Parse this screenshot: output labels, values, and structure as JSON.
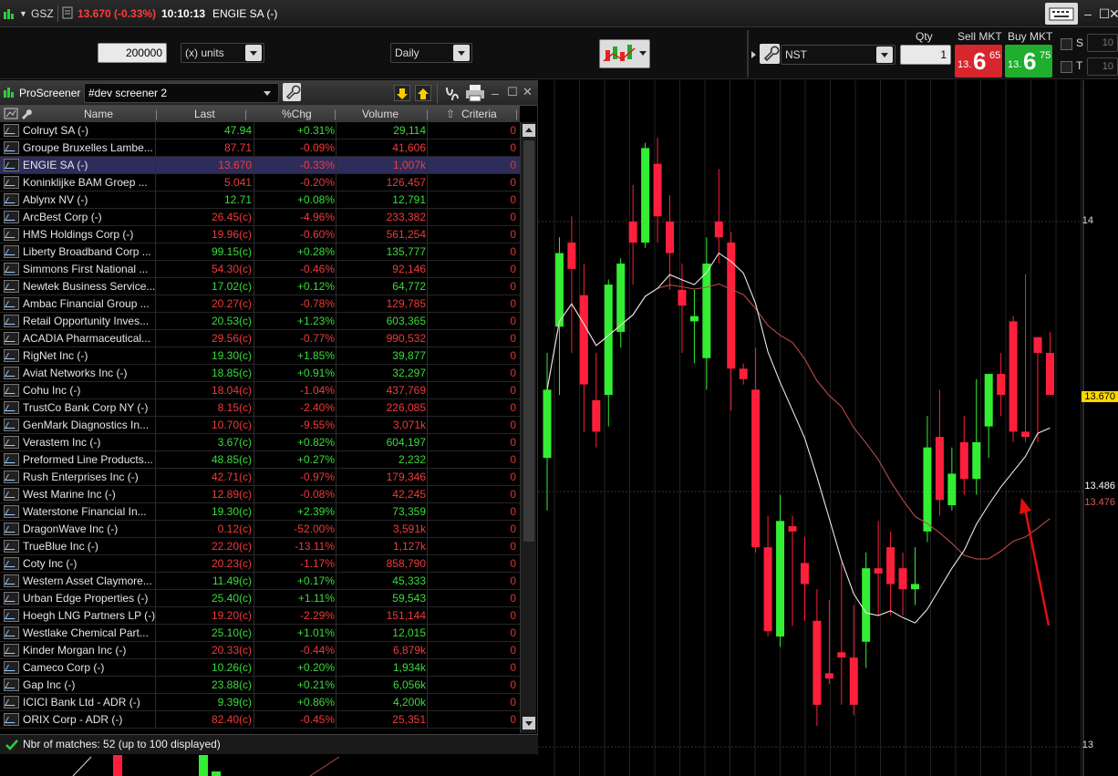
{
  "titlebar": {
    "symbol": "GSZ",
    "price_change": "13.670 (-0.33%)",
    "time": "10:10:13",
    "instrument": "ENGIE SA (-)"
  },
  "toolbar": {
    "quantity_value": "200000",
    "units_select": "(x) units",
    "period_select": "Daily",
    "order_type": "NST",
    "qty_label": "Qty",
    "qty_value": "1",
    "sell_label": "Sell MKT",
    "buy_label": "Buy MKT",
    "sell_price": {
      "small": "13.",
      "big": "6",
      "sup": "65"
    },
    "buy_price": {
      "small": "13.",
      "big": "6",
      "sup": "75"
    },
    "s_label": "S",
    "t_label": "T",
    "s_value": "10",
    "t_value": "10"
  },
  "screener": {
    "app_label": "ProScreener",
    "screener_name": "#dev screener 2",
    "columns": {
      "name": "Name",
      "last": "Last",
      "chg": "%Chg",
      "volume": "Volume",
      "criteria": "Criteria"
    },
    "rows": [
      {
        "name": "Colruyt SA (-)",
        "last": "47.94",
        "chg": "+0.31%",
        "vol": "29,114",
        "crit": "0",
        "dir": "up"
      },
      {
        "name": "Groupe Bruxelles Lambe...",
        "last": "87.71",
        "chg": "-0.09%",
        "vol": "41,606",
        "crit": "0",
        "dir": "dn"
      },
      {
        "name": "ENGIE SA (-)",
        "last": "13.670",
        "chg": "-0.33%",
        "vol": "1,007k",
        "crit": "0",
        "dir": "dn",
        "selected": true
      },
      {
        "name": "Koninklijke BAM Groep ...",
        "last": "5.041",
        "chg": "-0.20%",
        "vol": "126,457",
        "crit": "0",
        "dir": "dn"
      },
      {
        "name": "Ablynx NV (-)",
        "last": "12.71",
        "chg": "+0.08%",
        "vol": "12,791",
        "crit": "0",
        "dir": "up"
      },
      {
        "name": "ArcBest Corp (-)",
        "last": "26.45(c)",
        "chg": "-4.96%",
        "vol": "233,382",
        "crit": "0",
        "dir": "dn"
      },
      {
        "name": "HMS Holdings Corp (-)",
        "last": "19.96(c)",
        "chg": "-0.60%",
        "vol": "561,254",
        "crit": "0",
        "dir": "dn"
      },
      {
        "name": "Liberty Broadband Corp ...",
        "last": "99.15(c)",
        "chg": "+0.28%",
        "vol": "135,777",
        "crit": "0",
        "dir": "up"
      },
      {
        "name": "Simmons First National ...",
        "last": "54.30(c)",
        "chg": "-0.46%",
        "vol": "92,146",
        "crit": "0",
        "dir": "dn"
      },
      {
        "name": "Newtek Business Service...",
        "last": "17.02(c)",
        "chg": "+0.12%",
        "vol": "64,772",
        "crit": "0",
        "dir": "up"
      },
      {
        "name": "Ambac Financial Group ...",
        "last": "20.27(c)",
        "chg": "-0.78%",
        "vol": "129,785",
        "crit": "0",
        "dir": "dn"
      },
      {
        "name": "Retail Opportunity Inves...",
        "last": "20.53(c)",
        "chg": "+1.23%",
        "vol": "603,365",
        "crit": "0",
        "dir": "up"
      },
      {
        "name": "ACADIA Pharmaceutical...",
        "last": "29.56(c)",
        "chg": "-0.77%",
        "vol": "990,532",
        "crit": "0",
        "dir": "dn"
      },
      {
        "name": "RigNet Inc (-)",
        "last": "19.30(c)",
        "chg": "+1.85%",
        "vol": "39,877",
        "crit": "0",
        "dir": "up"
      },
      {
        "name": "Aviat Networks Inc (-)",
        "last": "18.85(c)",
        "chg": "+0.91%",
        "vol": "32,297",
        "crit": "0",
        "dir": "up"
      },
      {
        "name": "Cohu Inc (-)",
        "last": "18.04(c)",
        "chg": "-1.04%",
        "vol": "437,769",
        "crit": "0",
        "dir": "dn"
      },
      {
        "name": "TrustCo Bank Corp NY (-)",
        "last": "8.15(c)",
        "chg": "-2.40%",
        "vol": "226,085",
        "crit": "0",
        "dir": "dn"
      },
      {
        "name": "GenMark Diagnostics In...",
        "last": "10.70(c)",
        "chg": "-9.55%",
        "vol": "3,071k",
        "crit": "0",
        "dir": "dn"
      },
      {
        "name": "Verastem Inc (-)",
        "last": "3.67(c)",
        "chg": "+0.82%",
        "vol": "604,197",
        "crit": "0",
        "dir": "up"
      },
      {
        "name": "Preformed Line Products...",
        "last": "48.85(c)",
        "chg": "+0.27%",
        "vol": "2,232",
        "crit": "0",
        "dir": "up"
      },
      {
        "name": "Rush Enterprises Inc (-)",
        "last": "42.71(c)",
        "chg": "-0.97%",
        "vol": "179,346",
        "crit": "0",
        "dir": "dn"
      },
      {
        "name": "West Marine Inc (-)",
        "last": "12.89(c)",
        "chg": "-0.08%",
        "vol": "42,245",
        "crit": "0",
        "dir": "dn"
      },
      {
        "name": "Waterstone Financial In...",
        "last": "19.30(c)",
        "chg": "+2.39%",
        "vol": "73,359",
        "crit": "0",
        "dir": "up"
      },
      {
        "name": "DragonWave Inc (-)",
        "last": "0.12(c)",
        "chg": "-52.00%",
        "vol": "3,591k",
        "crit": "0",
        "dir": "dn"
      },
      {
        "name": "TrueBlue Inc (-)",
        "last": "22.20(c)",
        "chg": "-13.11%",
        "vol": "1,127k",
        "crit": "0",
        "dir": "dn"
      },
      {
        "name": "Coty Inc (-)",
        "last": "20.23(c)",
        "chg": "-1.17%",
        "vol": "858,790",
        "crit": "0",
        "dir": "dn"
      },
      {
        "name": "Western Asset Claymore...",
        "last": "11.49(c)",
        "chg": "+0.17%",
        "vol": "45,333",
        "crit": "0",
        "dir": "up"
      },
      {
        "name": "Urban Edge Properties (-)",
        "last": "25.40(c)",
        "chg": "+1.11%",
        "vol": "59,543",
        "crit": "0",
        "dir": "up"
      },
      {
        "name": "Hoegh LNG Partners LP (-)",
        "last": "19.20(c)",
        "chg": "-2.29%",
        "vol": "151,144",
        "crit": "0",
        "dir": "dn"
      },
      {
        "name": "Westlake Chemical Part...",
        "last": "25.10(c)",
        "chg": "+1.01%",
        "vol": "12,015",
        "crit": "0",
        "dir": "up"
      },
      {
        "name": "Kinder Morgan Inc (-)",
        "last": "20.33(c)",
        "chg": "-0.44%",
        "vol": "6,879k",
        "crit": "0",
        "dir": "dn"
      },
      {
        "name": "Cameco Corp (-)",
        "last": "10.26(c)",
        "chg": "+0.20%",
        "vol": "1,934k",
        "crit": "0",
        "dir": "up"
      },
      {
        "name": "Gap Inc (-)",
        "last": "23.88(c)",
        "chg": "+0.21%",
        "vol": "6,056k",
        "crit": "0",
        "dir": "up"
      },
      {
        "name": "ICICI Bank Ltd - ADR (-)",
        "last": "9.39(c)",
        "chg": "+0.86%",
        "vol": "4,200k",
        "crit": "0",
        "dir": "up"
      },
      {
        "name": "ORIX Corp - ADR (-)",
        "last": "82.40(c)",
        "chg": "-0.45%",
        "vol": "25,351",
        "crit": "0",
        "dir": "dn"
      }
    ],
    "status_text": "Nbr of matches: 52 (up to 100 displayed)"
  },
  "chart": {
    "price_labels": {
      "top": "14",
      "bottom": "13",
      "last": "13.670",
      "ma_white": "13.486",
      "ma_red": "13.476"
    },
    "colors": {
      "up": "#33ee33",
      "down": "#ff1f3d",
      "ma_white": "#e8e8e8",
      "ma_red": "#b94a4a",
      "last_bg": "#ffd700"
    },
    "candles": [
      {
        "o": 13.55,
        "h": 13.75,
        "l": 13.45,
        "c": 13.68
      },
      {
        "o": 13.8,
        "h": 13.97,
        "l": 13.67,
        "c": 13.94
      },
      {
        "o": 13.96,
        "h": 14.01,
        "l": 13.75,
        "c": 13.91
      },
      {
        "o": 13.86,
        "h": 13.92,
        "l": 13.6,
        "c": 13.69
      },
      {
        "o": 13.66,
        "h": 13.75,
        "l": 13.57,
        "c": 13.6
      },
      {
        "o": 13.67,
        "h": 13.89,
        "l": 13.61,
        "c": 13.88
      },
      {
        "o": 13.79,
        "h": 13.93,
        "l": 13.76,
        "c": 13.92
      },
      {
        "o": 14.0,
        "h": 14.07,
        "l": 13.88,
        "c": 13.96
      },
      {
        "o": 13.96,
        "h": 14.15,
        "l": 13.95,
        "c": 14.14
      },
      {
        "o": 14.11,
        "h": 14.16,
        "l": 13.96,
        "c": 14.01
      },
      {
        "o": 14.0,
        "h": 14.05,
        "l": 13.87,
        "c": 13.94
      },
      {
        "o": 13.87,
        "h": 13.92,
        "l": 13.75,
        "c": 13.84
      },
      {
        "o": 13.81,
        "h": 13.87,
        "l": 13.73,
        "c": 13.82
      },
      {
        "o": 13.74,
        "h": 13.97,
        "l": 13.68,
        "c": 13.92
      },
      {
        "o": 14.0,
        "h": 14.1,
        "l": 13.92,
        "c": 13.97
      },
      {
        "o": 13.96,
        "h": 13.98,
        "l": 13.64,
        "c": 13.72
      },
      {
        "o": 13.72,
        "h": 13.73,
        "l": 13.69,
        "c": 13.7
      },
      {
        "o": 13.68,
        "h": 13.76,
        "l": 13.37,
        "c": 13.38
      },
      {
        "o": 13.38,
        "h": 13.44,
        "l": 13.21,
        "c": 13.22
      },
      {
        "o": 13.21,
        "h": 13.48,
        "l": 13.19,
        "c": 13.43
      },
      {
        "o": 13.42,
        "h": 13.44,
        "l": 13.23,
        "c": 13.41
      },
      {
        "o": 13.35,
        "h": 13.4,
        "l": 13.24,
        "c": 13.31
      },
      {
        "o": 13.24,
        "h": 13.3,
        "l": 13.04,
        "c": 13.08
      },
      {
        "o": 13.14,
        "h": 13.28,
        "l": 13.12,
        "c": 13.13
      },
      {
        "o": 13.18,
        "h": 13.35,
        "l": 13.08,
        "c": 13.17
      },
      {
        "o": 13.17,
        "h": 13.27,
        "l": 13.06,
        "c": 13.08
      },
      {
        "o": 13.2,
        "h": 13.37,
        "l": 13.15,
        "c": 13.34
      },
      {
        "o": 13.34,
        "h": 13.43,
        "l": 13.25,
        "c": 13.33
      },
      {
        "o": 13.38,
        "h": 13.41,
        "l": 13.25,
        "c": 13.31
      },
      {
        "o": 13.34,
        "h": 13.37,
        "l": 13.25,
        "c": 13.3
      },
      {
        "o": 13.3,
        "h": 13.38,
        "l": 13.27,
        "c": 13.31
      },
      {
        "o": 13.41,
        "h": 13.63,
        "l": 13.39,
        "c": 13.57
      },
      {
        "o": 13.59,
        "h": 13.68,
        "l": 13.44,
        "c": 13.47
      },
      {
        "o": 13.46,
        "h": 13.57,
        "l": 13.45,
        "c": 13.52
      },
      {
        "o": 13.58,
        "h": 13.63,
        "l": 13.48,
        "c": 13.51
      },
      {
        "o": 13.51,
        "h": 13.7,
        "l": 13.48,
        "c": 13.58
      },
      {
        "o": 13.61,
        "h": 13.7,
        "l": 13.55,
        "c": 13.71
      },
      {
        "o": 13.71,
        "h": 13.75,
        "l": 13.63,
        "c": 13.67
      },
      {
        "o": 13.81,
        "h": 13.82,
        "l": 13.58,
        "c": 13.6
      },
      {
        "o": 13.6,
        "h": 13.9,
        "l": 13.58,
        "c": 13.59
      },
      {
        "o": 13.78,
        "h": 13.78,
        "l": 13.58,
        "c": 13.75
      },
      {
        "o": 13.75,
        "h": 13.79,
        "l": 13.67,
        "c": 13.67
      }
    ]
  }
}
